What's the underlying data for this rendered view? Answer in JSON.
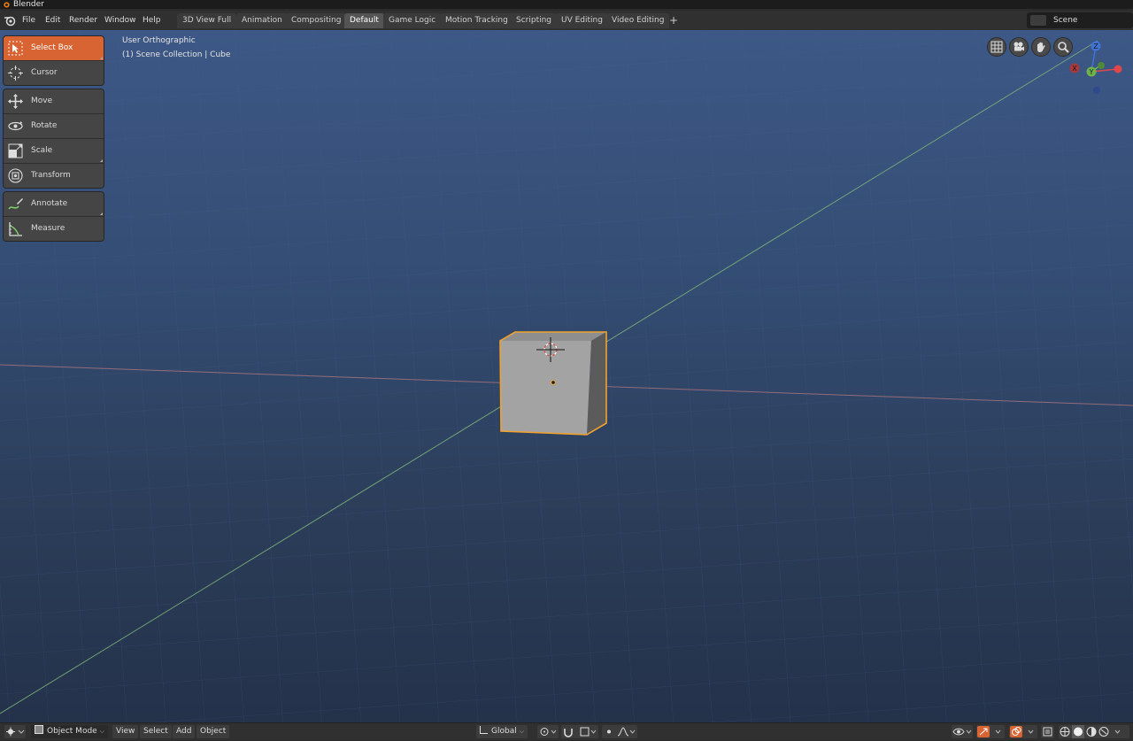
{
  "window": {
    "title": "Blender"
  },
  "menu": [
    "File",
    "Edit",
    "Render",
    "Window",
    "Help"
  ],
  "workspaces": [
    {
      "label": "3D View Full"
    },
    {
      "label": "Animation"
    },
    {
      "label": "Compositing"
    },
    {
      "label": "Default",
      "active": true
    },
    {
      "label": "Game Logic"
    },
    {
      "label": "Motion Tracking"
    },
    {
      "label": "Scripting"
    },
    {
      "label": "UV Editing"
    },
    {
      "label": "Video Editing"
    }
  ],
  "add_workspace": "+",
  "scene": {
    "name": "Scene"
  },
  "viewport": {
    "view_name": "User Orthographic",
    "collection_info": "(1) Scene Collection | Cube"
  },
  "tools": [
    {
      "label": "Select Box",
      "icon": "select-box-icon",
      "active": true
    },
    {
      "label": "Cursor",
      "icon": "cursor-icon"
    },
    {
      "label": "Move",
      "icon": "move-icon"
    },
    {
      "label": "Rotate",
      "icon": "rotate-icon"
    },
    {
      "label": "Scale",
      "icon": "scale-icon"
    },
    {
      "label": "Transform",
      "icon": "transform-icon"
    },
    {
      "label": "Annotate",
      "icon": "annotate-icon"
    },
    {
      "label": "Measure",
      "icon": "measure-icon"
    }
  ],
  "gizmo": {
    "x": "X",
    "y": "Y",
    "z": "Z"
  },
  "bottom": {
    "mode": "Object Mode",
    "menus": [
      "View",
      "Select",
      "Add",
      "Object"
    ],
    "orientation": "Global"
  },
  "colors": {
    "active_tool": "#d96433",
    "selection_outline": "#f2a22b",
    "axis_x": "#e0474a",
    "axis_y": "#6fb34c",
    "axis_z": "#3f73d6"
  }
}
